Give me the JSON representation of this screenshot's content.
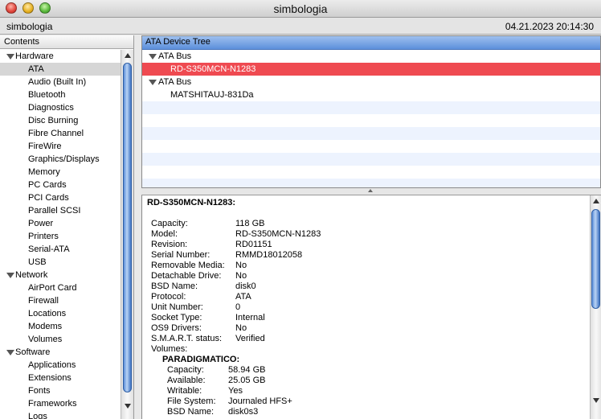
{
  "window": {
    "title": "simbologia"
  },
  "infobar": {
    "machine_name": "simbologia",
    "datetime": "04.21.2023 20:14:30"
  },
  "sidebar": {
    "header": "Contents",
    "categories": [
      {
        "label": "Hardware",
        "items": [
          "ATA",
          "Audio (Built In)",
          "Bluetooth",
          "Diagnostics",
          "Disc Burning",
          "Fibre Channel",
          "FireWire",
          "Graphics/Displays",
          "Memory",
          "PC Cards",
          "PCI Cards",
          "Parallel SCSI",
          "Power",
          "Printers",
          "Serial-ATA",
          "USB"
        ]
      },
      {
        "label": "Network",
        "items": [
          "AirPort Card",
          "Firewall",
          "Locations",
          "Modems",
          "Volumes"
        ]
      },
      {
        "label": "Software",
        "items": [
          "Applications",
          "Extensions",
          "Fonts",
          "Frameworks",
          "Logs"
        ]
      }
    ],
    "selected_item": "ATA"
  },
  "device_tree": {
    "header": "ATA Device Tree",
    "bus1": "ATA Bus",
    "device1": "RD-S350MCN-N1283",
    "bus2": "ATA Bus",
    "device2": "MATSHITAUJ-831Da"
  },
  "details": {
    "title": "RD-S350MCN-N1283:",
    "properties": [
      {
        "key": "Capacity:",
        "value": "118 GB"
      },
      {
        "key": "Model:",
        "value": "RD-S350MCN-N1283"
      },
      {
        "key": "Revision:",
        "value": "RD01151"
      },
      {
        "key": "Serial Number:",
        "value": "RMMD18012058"
      },
      {
        "key": "Removable Media:",
        "value": "No"
      },
      {
        "key": "Detachable Drive:",
        "value": "No"
      },
      {
        "key": "BSD Name:",
        "value": "disk0"
      },
      {
        "key": "Protocol:",
        "value": "ATA"
      },
      {
        "key": "Unit Number:",
        "value": "0"
      },
      {
        "key": "Socket Type:",
        "value": "Internal"
      },
      {
        "key": "OS9 Drivers:",
        "value": "No"
      },
      {
        "key": "S.M.A.R.T. status:",
        "value": "Verified"
      },
      {
        "key": "Volumes:",
        "value": ""
      }
    ],
    "volume": {
      "name": "PARADIGMATICO:",
      "properties": [
        {
          "key": "Capacity:",
          "value": "58.94 GB"
        },
        {
          "key": "Available:",
          "value": "25.05 GB"
        },
        {
          "key": "Writable:",
          "value": "Yes"
        },
        {
          "key": "File System:",
          "value": "Journaled HFS+"
        },
        {
          "key": "BSD Name:",
          "value": "disk0s3"
        }
      ]
    }
  },
  "colors": {
    "selection": "#ef4a51",
    "header_blue": "#5c8fdb",
    "stripe": "#edf3fe"
  }
}
